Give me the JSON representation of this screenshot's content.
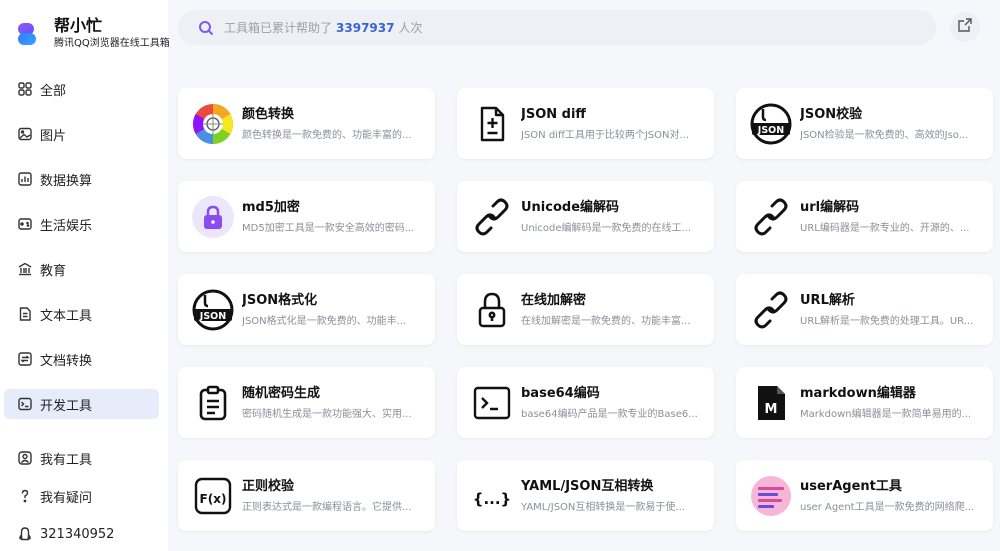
{
  "brand": {
    "name": "帮小忙",
    "subtitle": "腾讯QQ浏览器在线工具箱"
  },
  "search": {
    "prefix": "工具箱已累计帮助了",
    "count": "3397937",
    "suffix": "人次"
  },
  "nav": {
    "items": [
      {
        "label": "全部",
        "icon": "grid-icon"
      },
      {
        "label": "图片",
        "icon": "image-icon"
      },
      {
        "label": "数据换算",
        "icon": "chart-icon"
      },
      {
        "label": "生活娱乐",
        "icon": "gamepad-icon"
      },
      {
        "label": "教育",
        "icon": "bank-icon"
      },
      {
        "label": "文本工具",
        "icon": "document-icon"
      },
      {
        "label": "文档转换",
        "icon": "convert-icon"
      },
      {
        "label": "开发工具",
        "icon": "terminal-icon",
        "active": true
      }
    ],
    "bottom": [
      {
        "label": "我有工具",
        "icon": "user-icon"
      },
      {
        "label": "我有疑问",
        "icon": "question-icon"
      },
      {
        "label": "321340952",
        "icon": "qq-icon"
      }
    ]
  },
  "cards": [
    {
      "title": "颜色转换",
      "desc": "颜色转换是一款免费的、功能丰富的...",
      "icon": "color-wheel-icon"
    },
    {
      "title": "JSON diff",
      "desc": "JSON diff工具用于比较两个JSON对...",
      "icon": "file-diff-icon"
    },
    {
      "title": "JSON校验",
      "desc": "JSON检验是一款免费的、高效的Jso...",
      "icon": "json-badge-icon",
      "badge": "JSON"
    },
    {
      "title": "md5加密",
      "desc": "MD5加密工具是一款安全高效的密码...",
      "icon": "lock-purple-icon"
    },
    {
      "title": "Unicode编解码",
      "desc": "Unicode编解码是一款免费的在线工...",
      "icon": "link-icon"
    },
    {
      "title": "url编解码",
      "desc": "URL编码器是一款专业的、开源的、...",
      "icon": "link-icon"
    },
    {
      "title": "JSON格式化",
      "desc": "JSON格式化是一款免费的、功能丰...",
      "icon": "json-badge-icon",
      "badge": "JSON"
    },
    {
      "title": "在线加解密",
      "desc": "在线加解密是一款免费的、功能丰富...",
      "icon": "padlock-icon"
    },
    {
      "title": "URL解析",
      "desc": "URL解析是一款免费的处理工具。UR...",
      "icon": "link-icon"
    },
    {
      "title": "随机密码生成",
      "desc": "密码随机生成是一款功能强大、实用...",
      "icon": "clipboard-icon"
    },
    {
      "title": "base64编码",
      "desc": "base64编码产品是一款专业的Base6...",
      "icon": "terminal-icon"
    },
    {
      "title": "markdown编辑器",
      "desc": "Markdown编辑器是一款简单易用的...",
      "icon": "markdown-file-icon",
      "badge": "M"
    },
    {
      "title": "正则校验",
      "desc": "正则表达式是一款编程语言。它提供...",
      "icon": "function-icon",
      "badge": "F(x)"
    },
    {
      "title": "YAML/JSON互相转换",
      "desc": "YAML/JSON互相转换是一款易于使...",
      "icon": "braces-icon",
      "badge": "{...}"
    },
    {
      "title": "userAgent工具",
      "desc": "user Agent工具是一款免费的网络爬...",
      "icon": "useragent-icon"
    }
  ]
}
